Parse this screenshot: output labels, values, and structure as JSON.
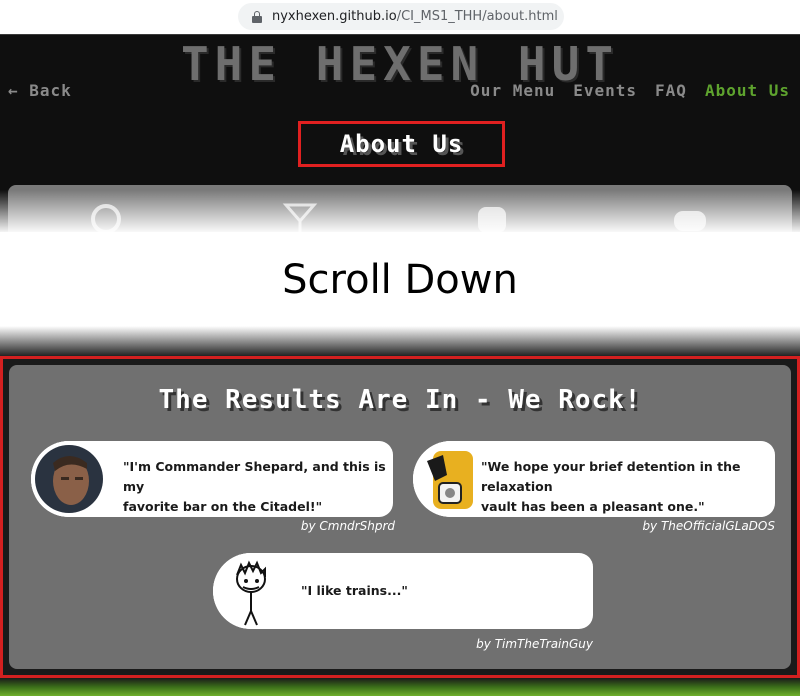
{
  "browser": {
    "url_host": "nyxhexen.github.io",
    "url_path": "/CI_MS1_THH/about.html"
  },
  "header": {
    "brand": "THE HEXEN HUT",
    "back_label": "← Back",
    "nav": [
      {
        "label": "Our Menu"
      },
      {
        "label": "Events"
      },
      {
        "label": "FAQ"
      },
      {
        "label": "About Us"
      }
    ],
    "page_title": "About Us"
  },
  "overlay": {
    "scroll_text": "Scroll Down"
  },
  "results": {
    "title": "The Results Are In - We Rock!",
    "reviews": [
      {
        "quote_line1": "\"I'm Commander Shepard, and this is my",
        "quote_line2": "favorite bar on the Citadel!\"",
        "byline": "by CmndrShprd"
      },
      {
        "quote_line1": "\"We hope your brief detention in the relaxation",
        "quote_line2": "vault has been a pleasant one.\"",
        "byline": "by TheOfficialGLaDOS"
      },
      {
        "quote_line1": "\"I like trains...\"",
        "quote_line2": "",
        "byline": "by TimTheTrainGuy"
      }
    ]
  },
  "colors": {
    "accent_red": "#d42020",
    "active_nav_green": "#5ea32e",
    "panel_grey": "#707070"
  }
}
